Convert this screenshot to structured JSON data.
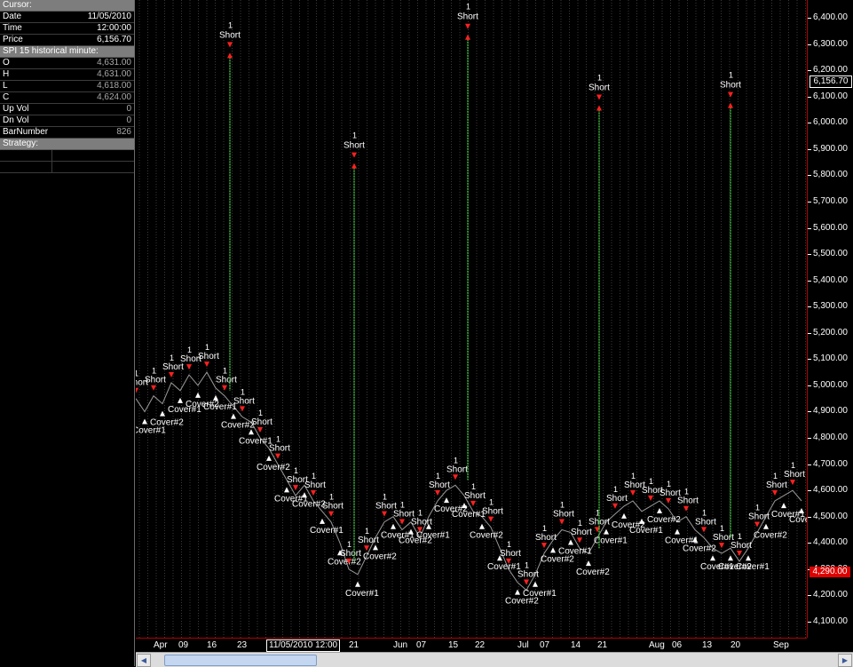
{
  "data_window": {
    "cursor_header": "Cursor:",
    "rows": [
      {
        "label": "Date",
        "value": "11/05/2010"
      },
      {
        "label": "Time",
        "value": "12:00:00"
      },
      {
        "label": "Price",
        "value": "6,156.70"
      }
    ],
    "symbol_header": "SPI 15 historical minute:",
    "ohlc": [
      {
        "label": "O",
        "value": "4,631.00"
      },
      {
        "label": "H",
        "value": "4,631.00"
      },
      {
        "label": "L",
        "value": "4,618.00"
      },
      {
        "label": "C",
        "value": "4,624.00"
      },
      {
        "label": "Up Vol",
        "value": "0"
      },
      {
        "label": "Dn Vol",
        "value": "0"
      },
      {
        "label": "BarNumber",
        "value": "826"
      }
    ],
    "strategy_header": "Strategy:"
  },
  "price_axis": {
    "labels": [
      "6,400.00",
      "6,300.00",
      "6,200.00",
      "6,100.00",
      "6,000.00",
      "5,900.00",
      "5,800.00",
      "5,700.00",
      "5,600.00",
      "5,500.00",
      "5,400.00",
      "5,300.00",
      "5,200.00",
      "5,100.00",
      "5,000.00",
      "4,900.00",
      "4,800.00",
      "4,700.00",
      "4,600.00",
      "4,500.00",
      "4,400.00",
      "4,300.00",
      "4,200.00",
      "4,100.00"
    ],
    "cursor_price": "6,156.70",
    "last_price": "4,290.00",
    "last_price_color": "#e00000"
  },
  "time_axis": {
    "labels": [
      "Apr",
      "09",
      "16",
      "23",
      "21",
      "Jun",
      "07",
      "15",
      "22",
      "Jul",
      "07",
      "14",
      "21",
      "Aug",
      "06",
      "13",
      "20",
      "Sep"
    ],
    "cursor_time": "11/05/2010 12:00"
  },
  "trades": {
    "short_label": "Short",
    "cover_label": "Cover#1",
    "cover2_label": "Cover#2",
    "qty_label": "1",
    "spikes": [
      {
        "price": 6260
      },
      {
        "price": 5840
      },
      {
        "price": 6330
      },
      {
        "price": 6060
      },
      {
        "price": 6070
      }
    ]
  },
  "colors": {
    "price_line": "#ffffff",
    "spike_line": "#3cb83c",
    "short_arrow": "#ff2020",
    "cover_arrow": "#ffffff",
    "grid": "#3a3a3a",
    "axis_border": "#b00000"
  }
}
